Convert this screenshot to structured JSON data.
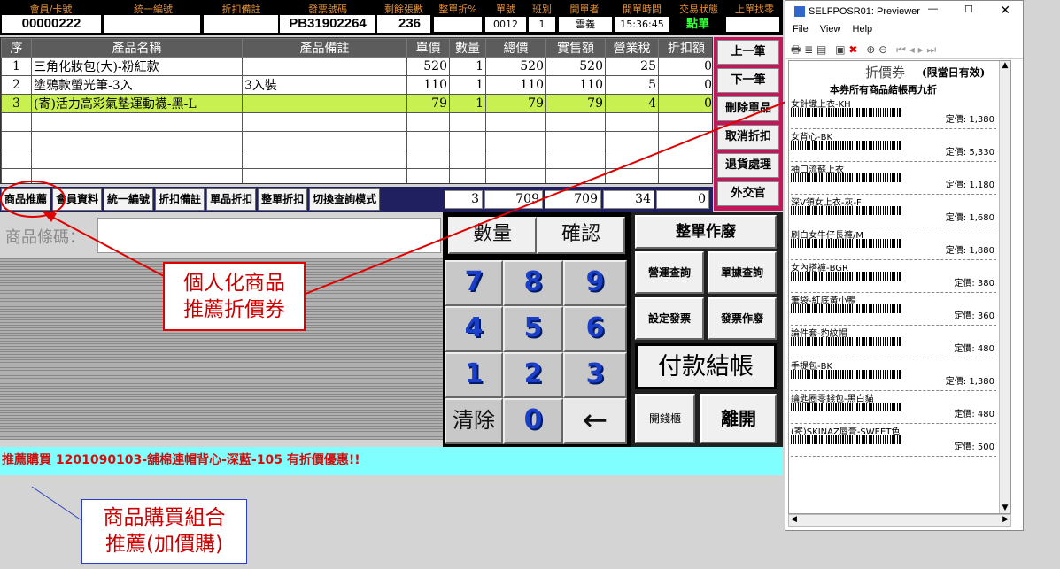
{
  "header": {
    "labels": {
      "member": "會員/卡號",
      "tax_id": "統一編號",
      "discount_note": "折扣備註",
      "invoice_no": "發票號碼",
      "remaining": "剩餘張數",
      "order_discount": "整單折%",
      "order_no": "單號",
      "shift": "班別",
      "cashier": "開單者",
      "open_time": "開單時間",
      "status": "交易狀態",
      "last_change": "上單找零"
    },
    "values": {
      "member": "00000222",
      "tax_id": "",
      "discount_note": "",
      "invoice_no": "PB31902264",
      "remaining": "236",
      "order_discount": "",
      "order_no": "0012",
      "shift": "1",
      "cashier": "雲義",
      "open_time": "15:36:45",
      "status": "點單",
      "last_change": ""
    }
  },
  "table": {
    "columns": [
      "序",
      "產品名稱",
      "產品備註",
      "單價",
      "數量",
      "總價",
      "實售額",
      "營業稅",
      "折扣額"
    ],
    "rows": [
      {
        "seq": "1",
        "name": "三角化妝包(大)-粉紅款",
        "note": "",
        "price": "520",
        "qty": "1",
        "total": "520",
        "sold": "520",
        "tax": "25",
        "discount": "0"
      },
      {
        "seq": "2",
        "name": "塗鴉款螢光筆-3入",
        "note": "3入裝",
        "price": "110",
        "qty": "1",
        "total": "110",
        "sold": "110",
        "tax": "5",
        "discount": "0"
      },
      {
        "seq": "3",
        "name": "(寄)活力高彩氣墊運動襪-黑-L",
        "note": "",
        "price": "79",
        "qty": "1",
        "total": "79",
        "sold": "79",
        "tax": "4",
        "discount": "0"
      }
    ]
  },
  "side_buttons": [
    "上一筆",
    "下一筆",
    "刪除單品",
    "取消折扣",
    "退貨處理",
    "外交官"
  ],
  "tabs": [
    "商品推薦",
    "會員資料",
    "統一編號",
    "折扣備註",
    "單品折扣",
    "整單折扣",
    "切換查詢模式"
  ],
  "totals": {
    "qty": "3",
    "total": "709",
    "sold": "709",
    "tax": "34",
    "discount": "0"
  },
  "barcode": {
    "label": "商品條碼：",
    "value": ""
  },
  "keypad": {
    "qty": "數量",
    "confirm": "確認",
    "keys": [
      "7",
      "8",
      "9",
      "4",
      "5",
      "6",
      "1",
      "2",
      "3"
    ],
    "clear": "清除",
    "zero": "0",
    "back": "←"
  },
  "ops": {
    "whole": "整單作廢",
    "bizq": "營運查詢",
    "docq": "單據查詢",
    "setinv": "設定發票",
    "voidinv": "發票作廢",
    "pay": "付款結帳",
    "drawer": "開錢櫃",
    "exit": "離開"
  },
  "message": "推薦購買 1201090103-舖棉連帽背心-深藍-105 有折價優惠!!",
  "callouts": {
    "coupon_l1": "個人化商品",
    "coupon_l2": "推薦折價券",
    "combo_l1": "商品購買組合",
    "combo_l2": "推薦(加價購)"
  },
  "colors": {
    "accent": "#c2185b",
    "header_label": "#e0903a",
    "selected_row": "#c8f050",
    "message_bg": "#7fffff",
    "callout_red": "#e00000"
  },
  "previewer": {
    "title": "SELFPOSR01: Previewer",
    "menu": [
      "File",
      "View",
      "Help"
    ],
    "coupon_title": "折價券",
    "coupon_valid": "(限當日有效)",
    "coupon_sub": "本券所有商品結帳再九折",
    "price_label": "定價:",
    "items": [
      {
        "name": "女針織上衣-KH",
        "price": "1,380"
      },
      {
        "name": "女背心-BK",
        "price": "5,330"
      },
      {
        "name": "袖口流蘇上衣",
        "price": "1,180"
      },
      {
        "name": "深V領女上衣-灰-F",
        "price": "1,680"
      },
      {
        "name": "刷白女牛仔長褲/M",
        "price": "1,880"
      },
      {
        "name": "女內搭褲-BGR",
        "price": "380"
      },
      {
        "name": "筆袋-紅底黃小鴨",
        "price": "360"
      },
      {
        "name": "論件套-豹紋帽",
        "price": "480"
      },
      {
        "name": "手提包-BK",
        "price": "1,380"
      },
      {
        "name": "鑰匙圈零錢包-黑白貓",
        "price": "480"
      },
      {
        "name": "(寄)SKINAZ唇膏-SWEET色",
        "price": "500"
      }
    ]
  }
}
